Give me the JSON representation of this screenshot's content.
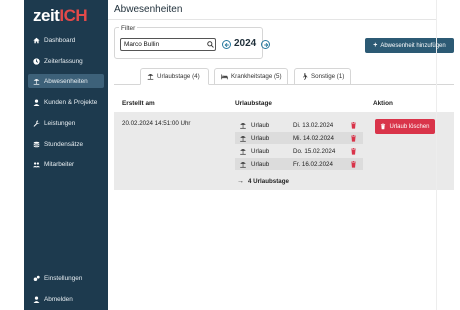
{
  "app": {
    "logo_zeit": "zeit",
    "logo_ich": "ICH"
  },
  "sidebar": {
    "items": [
      {
        "label": "Dashboard",
        "icon": "home-icon"
      },
      {
        "label": "Zeiterfassung",
        "icon": "clock-icon"
      },
      {
        "label": "Abwesenheiten",
        "icon": "beach-icon",
        "active": true
      },
      {
        "label": "Kunden & Projekte",
        "icon": "person-icon"
      },
      {
        "label": "Leistungen",
        "icon": "wrench-icon"
      },
      {
        "label": "Stundensätze",
        "icon": "coins-icon"
      },
      {
        "label": "Mitarbeiter",
        "icon": "users-icon"
      }
    ],
    "footer": [
      {
        "label": "Einstellungen",
        "icon": "gears-icon"
      },
      {
        "label": "Abmelden",
        "icon": "person-icon"
      }
    ]
  },
  "page": {
    "title": "Abwesenheiten"
  },
  "filter": {
    "label": "Filter",
    "search_value": "Marco Bullin",
    "year": "2024"
  },
  "actions": {
    "add_label": "Abwesenheit hinzufügen"
  },
  "tabs": [
    {
      "label": "Urlaubstage (4)",
      "icon": "beach-icon",
      "active": true
    },
    {
      "label": "Krankheitstage (5)",
      "icon": "bed-icon"
    },
    {
      "label": "Sonstige (1)",
      "icon": "person-walk-icon"
    }
  ],
  "table": {
    "headers": {
      "created": "Erstellt am",
      "days": "Urlaubstage",
      "action": "Aktion"
    },
    "row": {
      "created": "20.02.2024 14:51:00 Uhr",
      "days": [
        {
          "type": "Urlaub",
          "date": "Di. 13.02.2024"
        },
        {
          "type": "Urlaub",
          "date": "Mi. 14.02.2024"
        },
        {
          "type": "Urlaub",
          "date": "Do. 15.02.2024"
        },
        {
          "type": "Urlaub",
          "date": "Fr. 16.02.2024"
        }
      ],
      "summary": "4 Urlaubstage",
      "delete_label": "Urlaub löschen"
    }
  },
  "colors": {
    "sidebar": "#1d3a4e",
    "accent": "#2c5a74",
    "danger": "#d9344a",
    "logo_red": "#e24a4a"
  }
}
